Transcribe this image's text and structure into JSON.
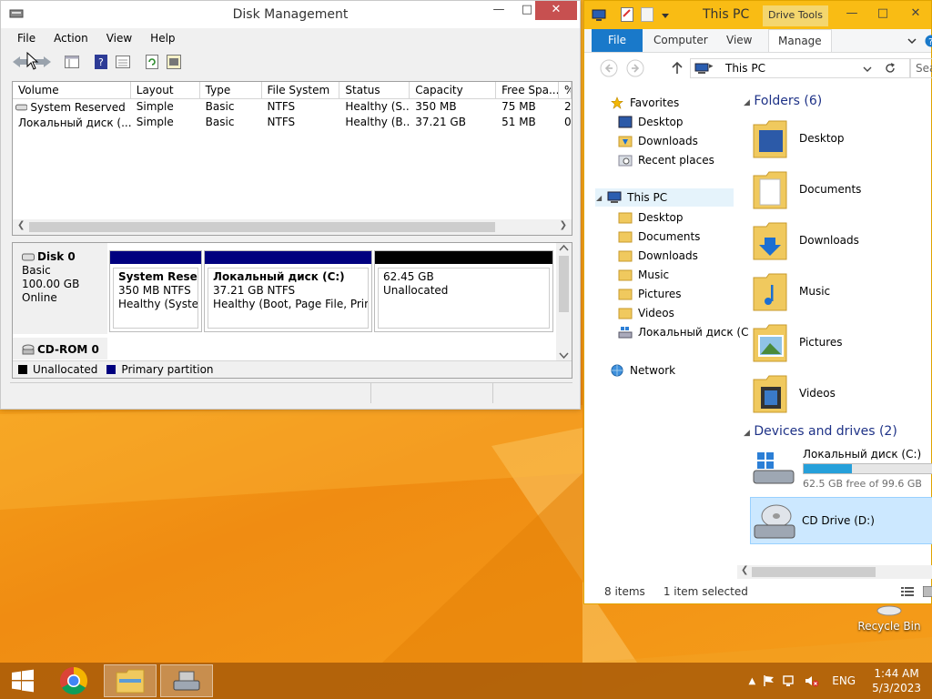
{
  "disk_mgmt": {
    "title": "Disk Management",
    "menu": [
      "File",
      "Action",
      "View",
      "Help"
    ],
    "columns": [
      "Volume",
      "Layout",
      "Type",
      "File System",
      "Status",
      "Capacity",
      "Free Spa...",
      "%"
    ],
    "volumes": [
      [
        "System Reserved",
        "Simple",
        "Basic",
        "NTFS",
        "Healthy (S...",
        "350 MB",
        "75 MB",
        "2"
      ],
      [
        "Локальный диск (...",
        "Simple",
        "Basic",
        "NTFS",
        "Healthy (B...",
        "37.21 GB",
        "51 MB",
        "0"
      ]
    ],
    "disk0": {
      "name": "Disk 0",
      "type": "Basic",
      "size": "100.00 GB",
      "state": "Online"
    },
    "partitions": [
      {
        "name": "System Reserve",
        "size": "350 MB NTFS",
        "status": "Healthy (System,",
        "bar_color": "#00007f"
      },
      {
        "name": "Локальный диск  (C:)",
        "size": "37.21 GB NTFS",
        "status": "Healthy (Boot, Page File, Primary",
        "bar_color": "#00007f"
      },
      {
        "name": "",
        "size": "62.45 GB",
        "status": "Unallocated",
        "bar_color": "#000000"
      }
    ],
    "cdrom": {
      "name": "CD-ROM 0"
    },
    "legend": [
      {
        "label": "Unallocated",
        "color": "#000000"
      },
      {
        "label": "Primary partition",
        "color": "#00007f"
      }
    ]
  },
  "explorer": {
    "title": "This PC",
    "drive_tools": "Drive Tools",
    "tabs": [
      "File",
      "Computer",
      "View",
      "Manage"
    ],
    "address": "This PC",
    "search_placeholder": "Sea",
    "nav": {
      "favorites": "Favorites",
      "fav_items": [
        "Desktop",
        "Downloads",
        "Recent places"
      ],
      "this_pc": "This PC",
      "pc_items": [
        "Desktop",
        "Documents",
        "Downloads",
        "Music",
        "Pictures",
        "Videos",
        "Локальный диск (C"
      ],
      "network": "Network"
    },
    "folders_header": "Folders (6)",
    "folders": [
      "Desktop",
      "Documents",
      "Downloads",
      "Music",
      "Pictures",
      "Videos"
    ],
    "devices_header": "Devices and drives (2)",
    "drive_c": {
      "name": "Локальный диск (C:)",
      "free": "62.5 GB free of 99.6 GB",
      "used_fraction": 0.37
    },
    "drive_d": {
      "name": "CD Drive (D:)"
    },
    "status_items": "8 items",
    "status_selected": "1 item selected"
  },
  "desktop": {
    "recycle_bin": "Recycle Bin"
  },
  "taskbar": {
    "lang": "ENG",
    "time": "1:44 AM",
    "date": "5/3/2023"
  }
}
